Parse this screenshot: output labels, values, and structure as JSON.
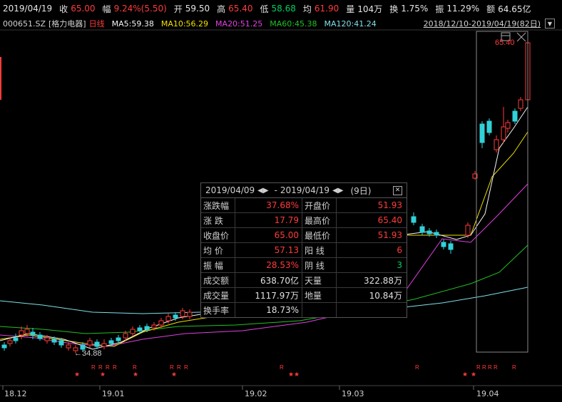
{
  "quote": {
    "date": "2019/04/19",
    "close_label": "收",
    "close": "65.00",
    "change_label": "幅",
    "change": "9.24%(5.50)",
    "open_label": "开",
    "open": "59.50",
    "high_label": "高",
    "high": "65.40",
    "low_label": "低",
    "low": "58.68",
    "avg_label": "均",
    "avg": "61.90",
    "volume_label": "量",
    "volume": "104万",
    "turnover_label": "换",
    "turnover": "1.75%",
    "amplitude_label": "振",
    "amplitude": "11.29%",
    "amount_label": "额",
    "amount": "64.65亿"
  },
  "ma_bar": {
    "code": "000651.SZ",
    "name": "[格力电器]",
    "period": "日线",
    "ma5": "MA5:59.38",
    "ma10": "MA10:56.29",
    "ma20": "MA20:51.25",
    "ma60": "MA60:45.38",
    "ma120": "MA120:41.24",
    "range": "2018/12/10-2019/04/19(82日)"
  },
  "colors": {
    "up": "#ff3b3b",
    "down": "#32d0d8",
    "ma5": "#f5f5f5",
    "ma10": "#f0e000",
    "ma20": "#e040e0",
    "ma60": "#22c022",
    "ma120": "#7fe0e8"
  },
  "chart": {
    "high_label": "65.40",
    "low_label": "←34.88",
    "x_labels": [
      "18.12",
      "19.01",
      "19.02",
      "19.03",
      "19.04"
    ]
  },
  "stats": {
    "start": "2019/04/09",
    "sep": "-",
    "end": "2019/04/19",
    "days": "(9日)",
    "rows": [
      {
        "k1": "涨跌幅",
        "v1": "37.68%",
        "k2": "开盘价",
        "v2": "51.93"
      },
      {
        "k1": "涨  跌",
        "v1": "17.79",
        "k2": "最高价",
        "v2": "65.40"
      },
      {
        "k1": "收盘价",
        "v1": "65.00",
        "k2": "最低价",
        "v2": "51.93"
      },
      {
        "k1": "均  价",
        "v1": "57.13",
        "k2": "阳  线",
        "v2": "6"
      },
      {
        "k1": "振  幅",
        "v1": "28.53%",
        "k2": "阴  线",
        "v2": "3"
      },
      {
        "k1": "成交额",
        "v1": "638.70亿",
        "k2": "天量",
        "v2": "322.88万"
      },
      {
        "k1": "成交量",
        "v1": "1117.97万",
        "k2": "地量",
        "v2": "10.84万"
      },
      {
        "k1": "换手率",
        "v1": "18.73%",
        "k2": "",
        "v2": ""
      }
    ]
  }
}
